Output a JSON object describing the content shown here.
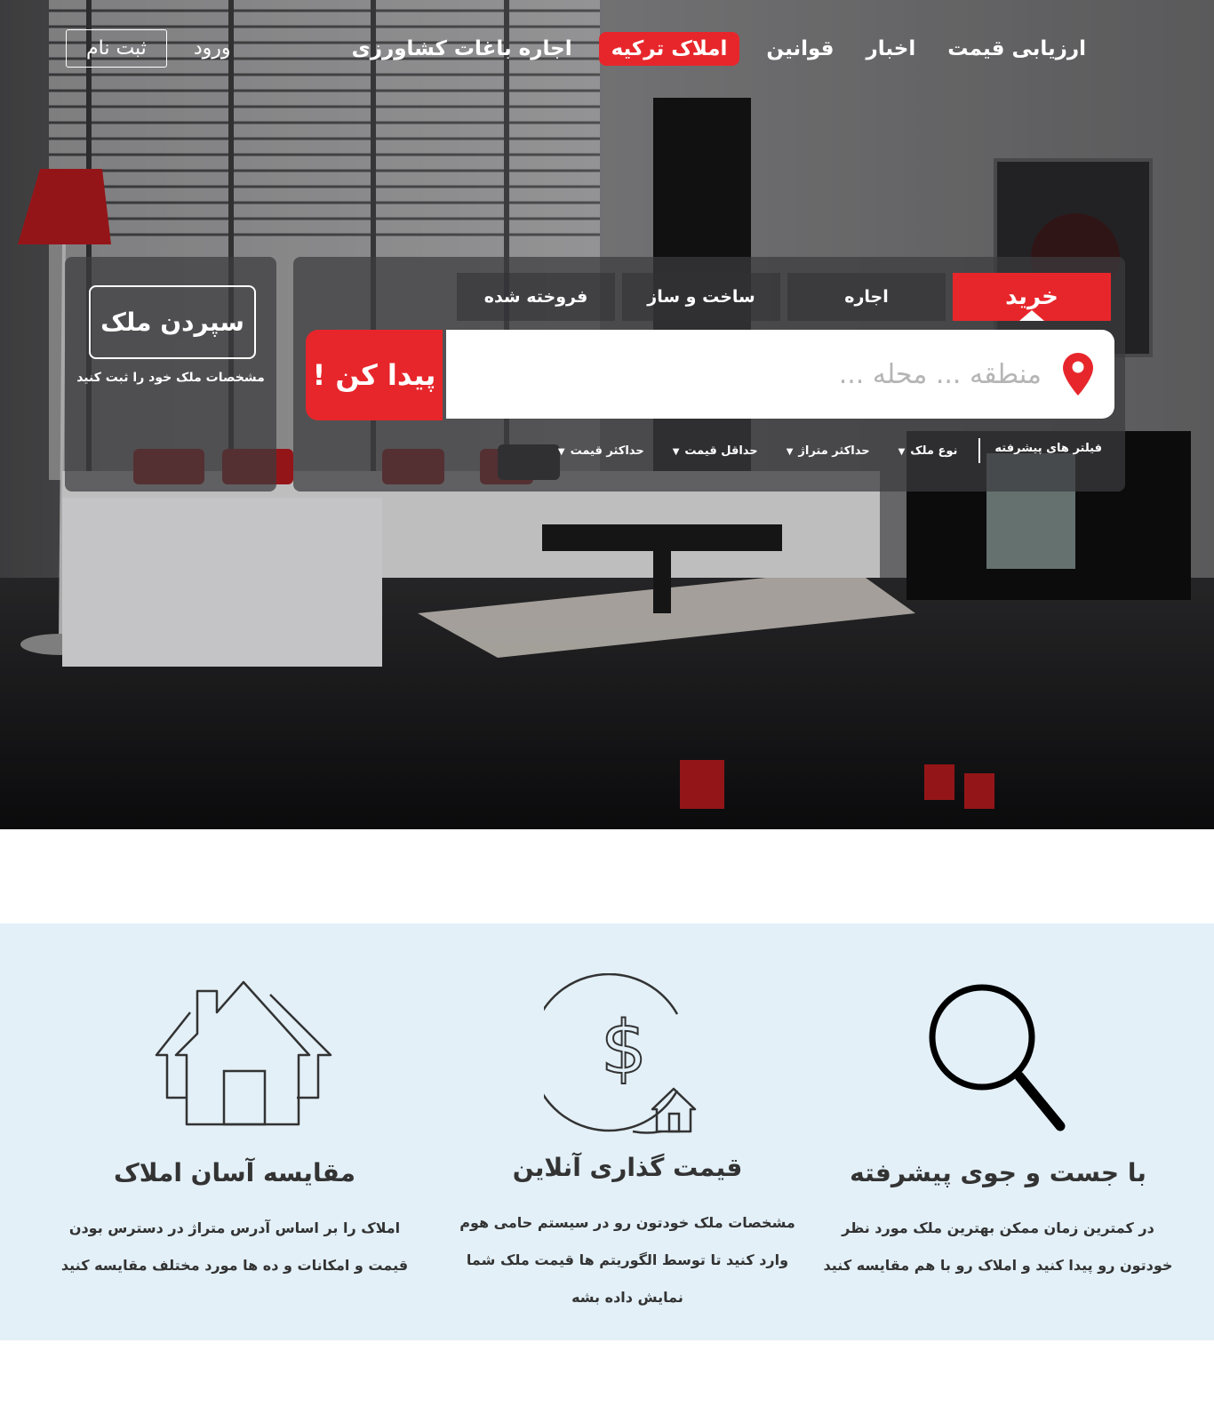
{
  "colors": {
    "accent": "#e7262b",
    "features_bg": "#e3f0f8",
    "text_dark": "#333333"
  },
  "nav": {
    "items": [
      {
        "label": "ارزیابی قیمت"
      },
      {
        "label": "اخبار"
      },
      {
        "label": "قوانین"
      },
      {
        "label": "املاک ترکیه"
      },
      {
        "label": "اجاره باغات کشاورزی"
      }
    ],
    "login": "ورود",
    "register": "ثبت نام"
  },
  "deposit": {
    "button": "سپردن ملک",
    "subtitle": "مشخصات ملک خود را ثبت کنید"
  },
  "search": {
    "tabs": [
      {
        "label": "خرید"
      },
      {
        "label": "اجاره"
      },
      {
        "label": "ساخت و ساز"
      },
      {
        "label": "فروخته شده"
      }
    ],
    "placeholder": "منطقه ... محله ...",
    "button": "پیدا کن !",
    "filters_title": "فیلتر های پیشرفته",
    "filters": [
      {
        "label": "نوع ملک"
      },
      {
        "label": "حداکثر متراژ"
      },
      {
        "label": "حداقل قیمت"
      },
      {
        "label": "حداکثر قیمت"
      }
    ]
  },
  "features": [
    {
      "icon": "search-icon",
      "title": "با جست و جوی پیشرفته",
      "text": "در کمترین زمان ممکن بهترین ملک مورد نظر خودتون رو پیدا کنید و املاک رو با هم مقایسه کنید"
    },
    {
      "icon": "dollar-home-icon",
      "title": "قیمت گذاری آنلاین",
      "text": "مشخصات ملک خودتون رو در سیستم حامی هوم وارد کنید تا توسط الگوریتم ها قیمت ملک شما نمایش داده بشه"
    },
    {
      "icon": "houses-icon",
      "title": "مقایسه آسان املاک",
      "text": "املاک را بر اساس آدرس متراژ در دسترس بودن قیمت و امکانات و ده ها مورد مختلف مقایسه کنید"
    }
  ]
}
